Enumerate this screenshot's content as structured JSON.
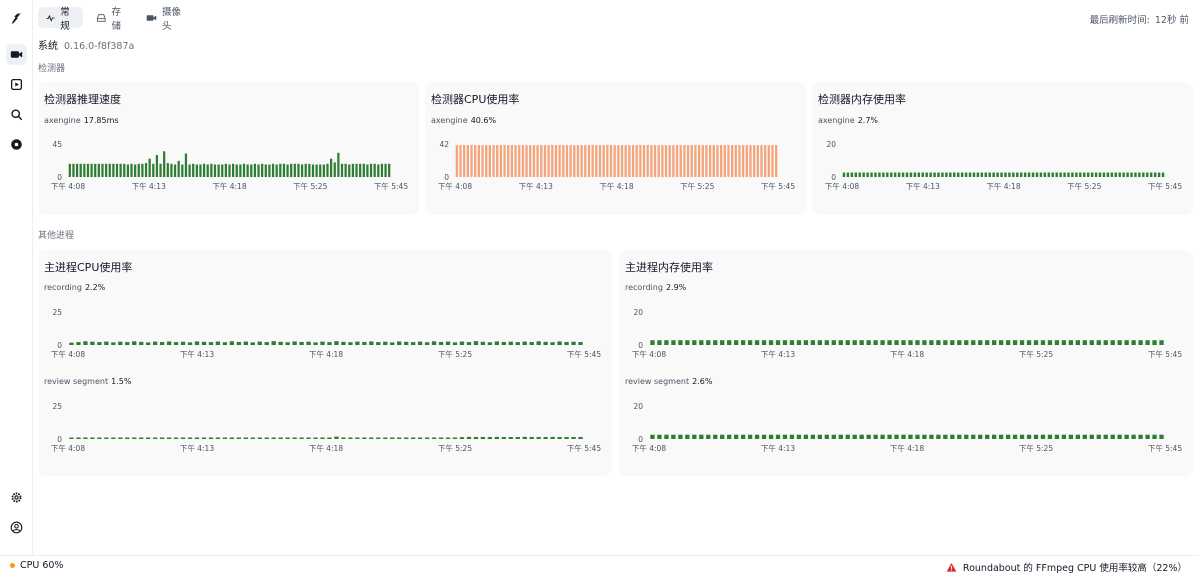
{
  "tabs": [
    {
      "label": "常规",
      "icon": "activity-icon",
      "active": true
    },
    {
      "label": "存储",
      "icon": "hard-drive-icon",
      "active": false
    },
    {
      "label": "摄像头",
      "icon": "video-camera-icon",
      "active": false
    }
  ],
  "refresh": {
    "label": "最后刷新时间:",
    "value": "12秒 前"
  },
  "system": {
    "label": "系统",
    "version": "0.16.0-f8f387a"
  },
  "sections": {
    "detectors": "检测器",
    "other": "其他进程"
  },
  "colors": {
    "green": "#2e7d32",
    "orange": "#f4a37a",
    "alert": "#dc2626",
    "status_dot": "#f59e0b"
  },
  "cards": {
    "detector_speed": {
      "title": "检测器推理速度"
    },
    "detector_cpu": {
      "title": "检测器CPU使用率"
    },
    "detector_mem": {
      "title": "检测器内存使用率"
    },
    "main_cpu": {
      "title": "主进程CPU使用率"
    },
    "main_mem": {
      "title": "主进程内存使用率"
    }
  },
  "chart_data": [
    {
      "id": "c1",
      "type": "bar",
      "series_name": "axengine",
      "current": "17.85ms",
      "y_ticks": [
        "45",
        "0"
      ],
      "ylim": [
        0,
        45
      ],
      "color": "#2e7d32",
      "x_labels": [
        "下午 4:08",
        "下午 4:13",
        "下午 4:18",
        "下午 5:25",
        "下午 5:45"
      ],
      "values": [
        18,
        18,
        18,
        18,
        18,
        18,
        18,
        18,
        18,
        18,
        18,
        18,
        18,
        18,
        18,
        18,
        17,
        18,
        17,
        18,
        18,
        19,
        25,
        18,
        30,
        18,
        35,
        19,
        18,
        17,
        22,
        17,
        32,
        17,
        18,
        17,
        17,
        18,
        17,
        18,
        17,
        17,
        17,
        18,
        17,
        18,
        17,
        17,
        18,
        17,
        17,
        18,
        17,
        18,
        17,
        17,
        18,
        17,
        18,
        18,
        17,
        18,
        18,
        18,
        17,
        18,
        18,
        17,
        17,
        17,
        17,
        18,
        25,
        20,
        33,
        18,
        18,
        17,
        18,
        18,
        18,
        18,
        17,
        18,
        18,
        17,
        18,
        18,
        18
      ]
    },
    {
      "id": "c2",
      "type": "bar",
      "series_name": "axengine",
      "current": "40.6%",
      "y_ticks": [
        "42",
        "0"
      ],
      "ylim": [
        0,
        42
      ],
      "color": "#f4a37a",
      "x_labels": [
        "下午 4:08",
        "下午 4:13",
        "下午 4:18",
        "下午 5:25",
        "下午 5:45"
      ],
      "values": [
        40.6,
        40.6,
        40.6,
        40.6,
        40.6,
        40.6,
        40.6,
        40.6,
        40.6,
        40.6,
        40.6,
        40.6,
        40.6,
        40.6,
        40.6,
        40.6,
        40.6,
        40.6,
        40.6,
        40.6,
        40.6,
        40.6,
        40.6,
        40.6,
        40.6,
        40.6,
        40.6,
        40.6,
        40.6,
        40.6,
        40.6,
        40.6,
        40.6,
        40.6,
        40.6,
        40.6,
        40.6,
        40.6,
        40.6,
        40.6,
        40.6,
        40.6,
        40.6,
        40.6,
        40.6,
        40.6,
        40.6,
        40.6,
        40.6,
        40.6,
        40.6,
        40.6,
        40.6,
        40.6,
        40.6,
        40.6,
        40.6,
        40.6,
        40.6,
        40.6,
        40.6,
        40.6,
        40.6,
        40.6,
        40.6,
        40.6,
        40.6,
        40.6,
        40.6,
        40.6,
        40.6,
        40.6,
        40.6,
        40.6,
        40.6,
        40.6,
        40.6,
        40.6,
        40.6,
        40.6,
        40.6,
        40.6,
        40.6,
        40.6,
        40.6,
        40.6,
        40.6,
        40.6
      ]
    },
    {
      "id": "c3",
      "type": "bar",
      "series_name": "axengine",
      "current": "2.7%",
      "y_ticks": [
        "20",
        "0"
      ],
      "ylim": [
        0,
        20
      ],
      "color": "#2e7d32",
      "x_labels": [
        "下午 4:08",
        "下午 4:13",
        "下午 4:18",
        "下午 5:25",
        "下午 5:45"
      ],
      "values": [
        2.7,
        2.7,
        2.7,
        2.7,
        2.7,
        2.7,
        2.7,
        2.7,
        2.7,
        2.7,
        2.7,
        2.7,
        2.7,
        2.7,
        2.7,
        2.7,
        2.7,
        2.7,
        2.7,
        2.7,
        2.7,
        2.7,
        2.7,
        2.7,
        2.7,
        2.7,
        2.7,
        2.7,
        2.7,
        2.7,
        2.7,
        2.7,
        2.7,
        2.7,
        2.7,
        2.7,
        2.7,
        2.7,
        2.7,
        2.7,
        2.7,
        2.7,
        2.7,
        2.7,
        2.7,
        2.7,
        2.7,
        2.7,
        2.7,
        2.7,
        2.7,
        2.7,
        2.7,
        2.7,
        2.7,
        2.7,
        2.7,
        2.7,
        2.7,
        2.7,
        2.7,
        2.7,
        2.7,
        2.7,
        2.7,
        2.7,
        2.7,
        2.7,
        2.7,
        2.7,
        2.7,
        2.7,
        2.7,
        2.7,
        2.7,
        2.7,
        2.7,
        2.7,
        2.7,
        2.7,
        2.7,
        2.7
      ]
    },
    {
      "id": "c4",
      "type": "bar",
      "series_name": "recording",
      "current": "2.2%",
      "y_ticks": [
        "25",
        "0"
      ],
      "ylim": [
        0,
        25
      ],
      "color": "#2e7d32",
      "x_labels": [
        "下午 4:08",
        "下午 4:13",
        "下午 4:18",
        "下午 5:25",
        "下午 5:45"
      ],
      "values": [
        1.8,
        2.2,
        2.8,
        2.5,
        2.2,
        2.6,
        2.0,
        2.5,
        2.2,
        2.8,
        2.4,
        2.0,
        2.6,
        2.3,
        2.7,
        2.2,
        2.5,
        2.0,
        2.7,
        2.4,
        2.2,
        2.6,
        2.1,
        2.8,
        2.3,
        2.6,
        2.0,
        2.6,
        2.2,
        2.9,
        2.4,
        2.1,
        2.7,
        2.3,
        2.5,
        2.0,
        2.6,
        2.2,
        2.9,
        2.4,
        2.1,
        2.6,
        2.3,
        2.7,
        2.2,
        2.5,
        2.0,
        2.7,
        2.4,
        2.2,
        2.6,
        2.1,
        2.8,
        2.3,
        2.6,
        2.0,
        2.6,
        2.2,
        2.9,
        2.4,
        2.1,
        2.7,
        2.3,
        2.5,
        2.2,
        2.6,
        2.2,
        2.8,
        2.4,
        2.1,
        2.7,
        2.3,
        2.5,
        2.2
      ]
    },
    {
      "id": "c5",
      "type": "bar",
      "series_name": "recording",
      "current": "2.9%",
      "y_ticks": [
        "20",
        "0"
      ],
      "ylim": [
        0,
        20
      ],
      "color": "#2e7d32",
      "x_labels": [
        "下午 4:08",
        "下午 4:13",
        "下午 4:18",
        "下午 5:25",
        "下午 5:45"
      ],
      "values": [
        2.9,
        2.9,
        2.9,
        2.9,
        2.9,
        2.9,
        2.9,
        2.9,
        2.9,
        2.9,
        2.9,
        2.9,
        2.9,
        2.9,
        2.9,
        2.9,
        2.9,
        2.9,
        2.9,
        2.9,
        2.9,
        2.9,
        2.9,
        2.9,
        2.9,
        2.9,
        2.9,
        2.9,
        2.9,
        2.9,
        2.9,
        2.9,
        2.9,
        2.9,
        2.9,
        2.9,
        2.9,
        2.9,
        2.9,
        2.9,
        2.9,
        2.9,
        2.9,
        2.9,
        2.9,
        2.9,
        2.9,
        2.9,
        2.9,
        2.9,
        2.9,
        2.9,
        2.9,
        2.9,
        2.9,
        2.9,
        2.9,
        2.9,
        2.9,
        2.9,
        2.9,
        2.9,
        2.9,
        2.9,
        2.9,
        2.9,
        2.9,
        2.9,
        2.9,
        2.9,
        2.9,
        2.9,
        2.9,
        2.9
      ]
    },
    {
      "id": "c6",
      "type": "bar",
      "series_name": "review segment",
      "current": "1.5%",
      "y_ticks": [
        "25",
        "0"
      ],
      "ylim": [
        0,
        25
      ],
      "color": "#2e7d32",
      "x_labels": [
        "下午 4:08",
        "下午 4:13",
        "下午 4:18",
        "下午 5:25",
        "下午 5:45"
      ],
      "values": [
        1.0,
        1.0,
        1.1,
        1.0,
        1.0,
        1.1,
        1.0,
        1.0,
        1.0,
        1.1,
        1.0,
        1.0,
        1.0,
        1.1,
        1.0,
        1.0,
        1.0,
        1.0,
        1.1,
        1.0,
        1.0,
        1.0,
        1.0,
        1.1,
        1.0,
        1.0,
        1.0,
        1.0,
        1.1,
        1.0,
        1.0,
        1.0,
        1.0,
        1.1,
        1.0,
        1.0,
        1.0,
        1.0,
        1.8,
        1.0,
        1.0,
        1.0,
        1.1,
        1.0,
        1.0,
        1.0,
        1.0,
        1.1,
        1.0,
        1.0,
        1.0,
        1.0,
        1.1,
        1.0,
        1.0,
        1.0,
        1.4,
        1.6,
        1.5,
        1.5,
        1.5,
        1.6,
        1.5,
        1.5,
        1.5,
        1.6,
        1.5,
        1.5,
        1.5,
        1.6,
        1.5,
        1.5,
        1.5,
        1.5
      ]
    },
    {
      "id": "c7",
      "type": "bar",
      "series_name": "review segment",
      "current": "2.6%",
      "y_ticks": [
        "20",
        "0"
      ],
      "ylim": [
        0,
        20
      ],
      "color": "#2e7d32",
      "x_labels": [
        "下午 4:08",
        "下午 4:13",
        "下午 4:18",
        "下午 5:25",
        "下午 5:45"
      ],
      "values": [
        2.6,
        2.6,
        2.6,
        2.6,
        2.6,
        2.6,
        2.6,
        2.6,
        2.6,
        2.6,
        2.6,
        2.6,
        2.6,
        2.6,
        2.6,
        2.6,
        2.6,
        2.6,
        2.6,
        2.6,
        2.6,
        2.6,
        2.6,
        2.6,
        2.6,
        2.6,
        2.6,
        2.6,
        2.6,
        2.6,
        2.6,
        2.6,
        2.6,
        2.6,
        2.6,
        2.6,
        2.6,
        2.6,
        2.6,
        2.6,
        2.6,
        2.6,
        2.6,
        2.6,
        2.6,
        2.6,
        2.6,
        2.6,
        2.6,
        2.6,
        2.6,
        2.6,
        2.6,
        2.6,
        2.6,
        2.6,
        2.6,
        2.6,
        2.6,
        2.6,
        2.6,
        2.6,
        2.6,
        2.6,
        2.6,
        2.6,
        2.6,
        2.6,
        2.6,
        2.6,
        2.6,
        2.6,
        2.6,
        2.6
      ]
    }
  ],
  "status": {
    "cpu": "CPU 60%",
    "alert": "Roundabout 的 FFmpeg CPU 使用率较高（22%）"
  }
}
